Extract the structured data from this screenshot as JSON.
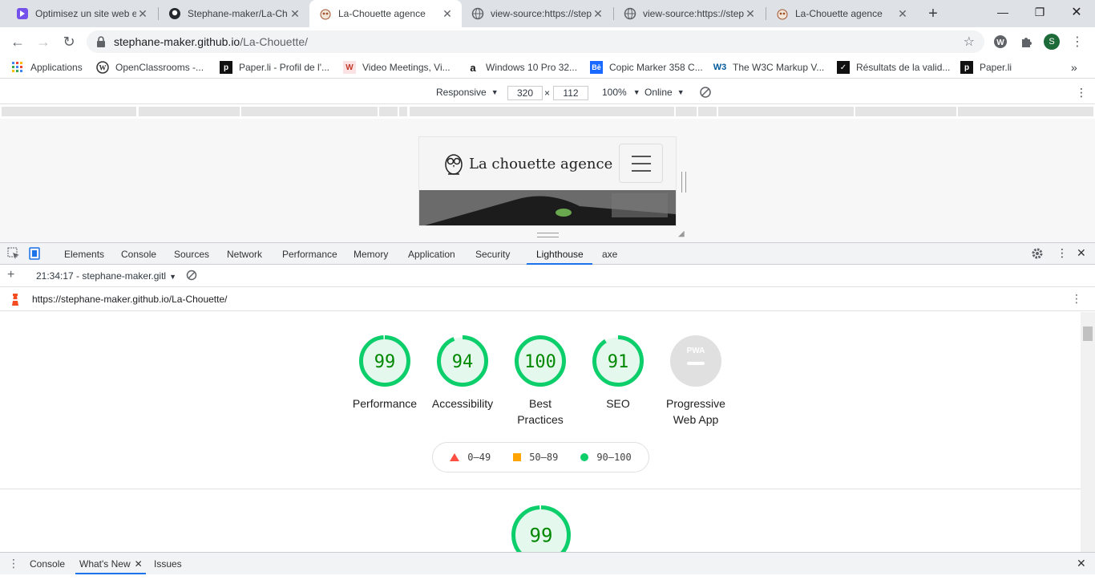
{
  "browser": {
    "tabs": [
      {
        "title": "Optimisez un site web e",
        "icon": "openclassrooms-icon"
      },
      {
        "title": "Stephane-maker/La-Ch",
        "icon": "github-icon"
      },
      {
        "title": "La-Chouette agence",
        "icon": "owl-icon",
        "active": true
      },
      {
        "title": "view-source:https://step",
        "icon": "globe-icon"
      },
      {
        "title": "view-source:https://step",
        "icon": "globe-icon"
      },
      {
        "title": "La-Chouette agence",
        "icon": "owl-icon"
      }
    ],
    "new_tab": "+",
    "address": {
      "host": "stephane-maker.github.io",
      "path": "/La-Chouette/"
    },
    "profile_initial": "S"
  },
  "bookmarks": [
    {
      "label": "Applications",
      "icon": "apps-grid-icon"
    },
    {
      "label": "OpenClassrooms -...",
      "icon": "wordpress-icon"
    },
    {
      "label": "Paper.li - Profil de l'...",
      "icon": "paperli-icon"
    },
    {
      "label": "Video Meetings, Vi...",
      "icon": "whereby-icon"
    },
    {
      "label": "Windows 10 Pro 32...",
      "icon": "amazon-icon"
    },
    {
      "label": "Copic Marker 358 C...",
      "icon": "behance-icon"
    },
    {
      "label": "The W3C Markup V...",
      "icon": "w3c-icon"
    },
    {
      "label": "Résultats de la valid...",
      "icon": "validator-icon"
    },
    {
      "label": "Paper.li",
      "icon": "paperli-icon"
    }
  ],
  "device_toolbar": {
    "mode": "Responsive",
    "width": "320",
    "times": "×",
    "height": "112",
    "zoom": "100%",
    "network": "Online"
  },
  "site": {
    "logo_text": "La chouette agence"
  },
  "devtools": {
    "tabs": [
      "Elements",
      "Console",
      "Sources",
      "Network",
      "Performance",
      "Memory",
      "Application",
      "Security",
      "Lighthouse",
      "axe"
    ],
    "active_tab": "Lighthouse",
    "report_select": "21:34:17 - stephane-maker.gitl",
    "report_url": "https://stephane-maker.github.io/La-Chouette/"
  },
  "lighthouse": {
    "scores": [
      {
        "value": 99,
        "label1": "Performance",
        "label2": ""
      },
      {
        "value": 94,
        "label1": "Accessibility",
        "label2": ""
      },
      {
        "value": 100,
        "label1": "Best",
        "label2": "Practices"
      },
      {
        "value": 91,
        "label1": "SEO",
        "label2": ""
      }
    ],
    "pwa": {
      "label1": "Progressive",
      "label2": "Web App",
      "badge": "PWA"
    },
    "legend": [
      "0–49",
      "50–89",
      "90–100"
    ],
    "section_score": 99,
    "colors": {
      "pass": "#0cce6b",
      "average": "#ffa400",
      "fail": "#ff4e42",
      "pass_text": "#008800",
      "na": "#e0e0e0"
    }
  },
  "drawer": {
    "tabs": [
      "Console",
      "What's New",
      "Issues"
    ],
    "active": "What's New"
  }
}
